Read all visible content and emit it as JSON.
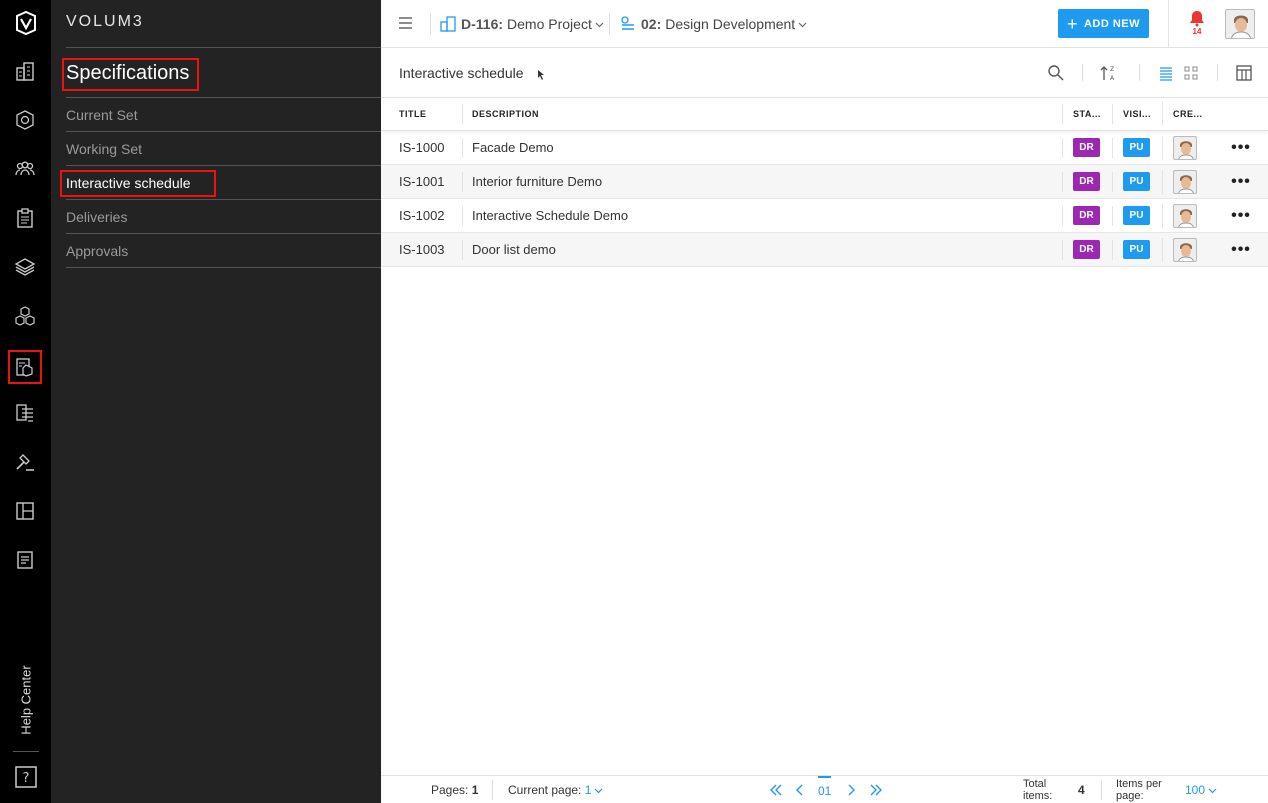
{
  "app": {
    "brand": "VOLUM3",
    "help_label": "Help Center"
  },
  "rail": {
    "icons": [
      "logo-icon",
      "buildings-icon",
      "settings-gear-icon",
      "team-icon",
      "clipboard-icon",
      "layers-icon",
      "cubes-icon",
      "specifications-icon",
      "documents-tree-icon",
      "gavel-icon",
      "layout-icon",
      "report-icon",
      "help-book-icon"
    ]
  },
  "sidebar": {
    "title": "Specifications",
    "items": [
      {
        "label": "Current Set"
      },
      {
        "label": "Working Set"
      },
      {
        "label": "Interactive schedule"
      },
      {
        "label": "Deliveries"
      },
      {
        "label": "Approvals"
      }
    ]
  },
  "topbar": {
    "project_code": "D-116:",
    "project_name": "Demo Project",
    "phase_code": "02:",
    "phase_name": "Design Development",
    "add_new": "ADD NEW",
    "notification_count": "14"
  },
  "toolbar": {
    "title": "Interactive schedule"
  },
  "table": {
    "columns": [
      "TITLE",
      "DESCRIPTION",
      "STA...",
      "VISI...",
      "CRE..."
    ],
    "rows": [
      {
        "title": "IS-1000",
        "description": "Facade Demo",
        "status": "DR",
        "visibility": "PU"
      },
      {
        "title": "IS-1001",
        "description": "Interior furniture Demo",
        "status": "DR",
        "visibility": "PU"
      },
      {
        "title": "IS-1002",
        "description": "Interactive Schedule Demo",
        "status": "DR",
        "visibility": "PU"
      },
      {
        "title": "IS-1003",
        "description": "Door list demo",
        "status": "DR",
        "visibility": "PU"
      }
    ]
  },
  "footer": {
    "pages_label": "Pages:",
    "pages_value": "1",
    "current_page_label": "Current page:",
    "current_page_value": "1",
    "page_number": "01",
    "total_label_1": "Total",
    "total_label_2": "items:",
    "total_value": "4",
    "per_page_label_1": "Items per",
    "per_page_label_2": "page:",
    "per_page_value": "100"
  },
  "colors": {
    "accent": "#1e9bef",
    "status_badge": "#9c27b0",
    "visibility_badge": "#1e9bef",
    "highlight": "#e11111",
    "notification": "#e33333"
  }
}
